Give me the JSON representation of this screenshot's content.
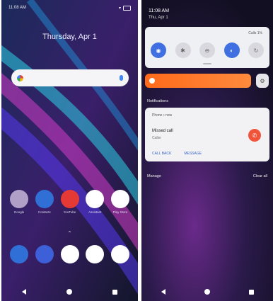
{
  "home": {
    "status_time": "11:08 AM",
    "date": "Thursday, Apr 1",
    "search_placeholder": "",
    "row1": [
      {
        "name": "Google",
        "icon": "settings-icon",
        "color": "#b0a0c8"
      },
      {
        "name": "Contacts",
        "icon": "contacts-icon",
        "color": "#2f6fd6"
      },
      {
        "name": "YouTube",
        "icon": "youtube-icon",
        "color": "#e53935"
      },
      {
        "name": "Assistant",
        "icon": "assistant-icon",
        "color": "#ffffff"
      },
      {
        "name": "Play Store",
        "icon": "play-store-icon",
        "color": "#ffffff"
      }
    ],
    "dock": [
      {
        "icon": "phone-icon",
        "color": "#2f6fd6"
      },
      {
        "icon": "messages-icon",
        "color": "#3d5fd8"
      },
      {
        "icon": "chrome-icon",
        "color": "#ffffff"
      },
      {
        "icon": "google-icon",
        "color": "#ffffff"
      },
      {
        "icon": "camera-icon",
        "color": "#ffffff"
      }
    ]
  },
  "shade": {
    "time": "11:08 AM",
    "date": "Thu, Apr 1",
    "util_text": "Calls 1%",
    "notifications_label": "Notifications",
    "card": {
      "app": "Phone • now",
      "title": "Missed call",
      "subtitle": "Caller",
      "actions": [
        "CALL BACK",
        "MESSAGE"
      ]
    },
    "manage_label": "Manage",
    "clear_label": "Clear all"
  }
}
